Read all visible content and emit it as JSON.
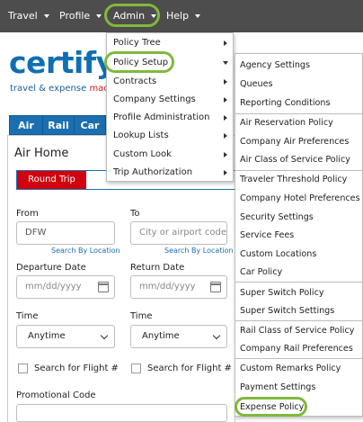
{
  "nav": {
    "items": [
      {
        "label": "Travel"
      },
      {
        "label": "Profile"
      },
      {
        "label": "Admin"
      },
      {
        "label": "Help"
      }
    ]
  },
  "logo": {
    "word": "certify",
    "tagline_start": "travel & expense ",
    "tagline_end": "mac"
  },
  "mode_tabs": [
    "Air",
    "Rail",
    "Car"
  ],
  "air_home": {
    "title": "Air Home",
    "trip_type_selected": "Round Trip",
    "from_label": "From",
    "from_value": "DFW",
    "to_label": "To",
    "to_placeholder": "City or airport code",
    "search_by_location": "Search By Location",
    "departure_label": "Departure Date",
    "return_label": "Return Date",
    "date_placeholder": "mm/dd/yyyy",
    "time_label": "Time",
    "time_value": "Anytime",
    "search_flight_label": "Search for Flight #",
    "promo_label": "Promotional Code"
  },
  "admin_menu": {
    "items": [
      {
        "label": "Policy Tree",
        "submenu": true
      },
      {
        "label": "Policy Setup",
        "submenu": true,
        "expanded": true
      },
      {
        "label": "Contracts",
        "submenu": true
      },
      {
        "label": "Company Settings",
        "submenu": true
      },
      {
        "label": "Profile Administration",
        "submenu": true
      },
      {
        "label": "Lookup Lists",
        "submenu": true
      },
      {
        "label": "Custom Look",
        "submenu": true
      },
      {
        "label": "Trip Authorization",
        "submenu": true
      }
    ]
  },
  "policy_setup_menu": {
    "groups": [
      [
        "Agency Settings",
        "Queues",
        "Reporting Conditions"
      ],
      [
        "Air Reservation Policy",
        "Company Air Preferences",
        "Air Class of Service Policy"
      ],
      [
        "Traveler Threshold Policy",
        "Company Hotel Preferences",
        "Security Settings",
        "Service Fees",
        "Custom Locations",
        "Car Policy"
      ],
      [
        "Super Switch Policy",
        "Super Switch Settings"
      ],
      [
        "Rail Class of Service Policy",
        "Company Rail Preferences"
      ],
      [
        "Custom Remarks Policy",
        "Payment Settings",
        "Expense Policy"
      ]
    ]
  },
  "colors": {
    "nav_bg": "#4d4d4d",
    "highlight": "#80b83c",
    "brand_blue": "#0f6fb3",
    "round_trip_red": "#d0030f"
  }
}
